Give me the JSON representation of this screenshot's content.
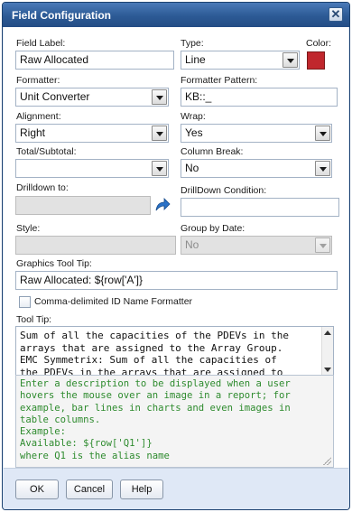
{
  "dialog": {
    "title": "Field Configuration",
    "close_icon": "close-icon",
    "close_glyph": "✕"
  },
  "field_label": {
    "label": "Field Label:",
    "value": "Raw Allocated"
  },
  "type": {
    "label": "Type:",
    "value": "Line"
  },
  "color": {
    "label": "Color:",
    "value": "#c0272d"
  },
  "formatter": {
    "label": "Formatter:",
    "value": "Unit Converter"
  },
  "formatter_pattern": {
    "label": "Formatter Pattern:",
    "value": "KB::_"
  },
  "alignment": {
    "label": "Alignment:",
    "value": "Right"
  },
  "wrap": {
    "label": "Wrap:",
    "value": "Yes"
  },
  "total_subtotal": {
    "label": "Total/Subtotal:",
    "value": ""
  },
  "column_break": {
    "label": "Column Break:",
    "value": "No"
  },
  "drilldown_to": {
    "label": "Drilldown to:",
    "value": "",
    "icon": "drilldown-arrow-icon"
  },
  "drilldown_condition": {
    "label": "DrillDown Condition:",
    "value": ""
  },
  "style": {
    "label": "Style:",
    "value": ""
  },
  "group_by_date": {
    "label": "Group by Date:",
    "value": "No"
  },
  "graphics_tooltip": {
    "label": "Graphics Tool Tip:",
    "value": "Raw Allocated: ${row['A']}"
  },
  "comma_delimited": {
    "label": "Comma-delimited ID Name Formatter",
    "checked": false
  },
  "tooltip": {
    "label": "Tool Tip:",
    "lines": [
      "Sum of all the capacities of the PDEVs in the",
      "arrays that are assigned to the Array Group.",
      "EMC Symmetrix: Sum of all the capacities of",
      "the PDEVs in the arrays that are assigned to"
    ]
  },
  "help_text": {
    "lines": [
      "Enter a description to be displayed when a user",
      "hovers the mouse over an image in a report; for",
      "example, bar lines in charts and even images in",
      "table columns.",
      "Example:",
      "Available: ${row['Q1']}",
      "where Q1 is the alias name"
    ]
  },
  "buttons": {
    "ok": "OK",
    "cancel": "Cancel",
    "help": "Help"
  }
}
